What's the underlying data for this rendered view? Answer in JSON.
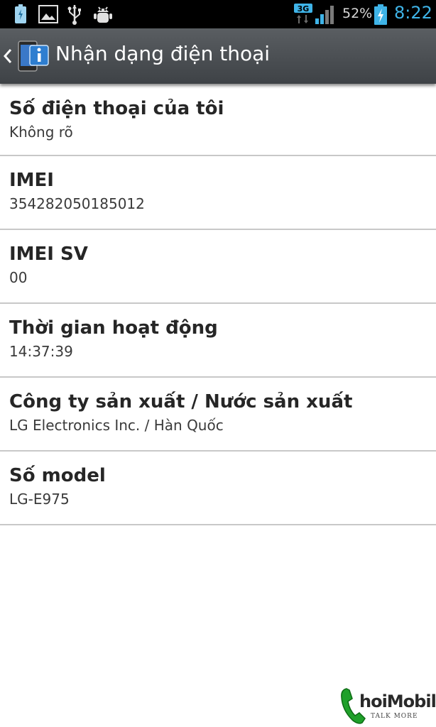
{
  "status_bar": {
    "notifications": [
      "battery-charging-notification-icon",
      "gallery-icon",
      "usb-icon",
      "debug-icon"
    ],
    "network": "3G",
    "battery_percent": "52%",
    "time": "8:22"
  },
  "action_bar": {
    "title": "Nhận dạng điện thoại"
  },
  "items": [
    {
      "label": "Số điện thoại của tôi",
      "value": "Không rõ"
    },
    {
      "label": "IMEI",
      "value": "354282050185012"
    },
    {
      "label": "IMEI SV",
      "value": "00"
    },
    {
      "label": "Thời gian hoạt động",
      "value": "14:37:39"
    },
    {
      "label": "Công ty sản xuất / Nước sản xuất",
      "value": "LG Electronics Inc. / Hàn Quốc"
    },
    {
      "label": "Số model",
      "value": "LG-E975"
    }
  ],
  "watermark": {
    "brand": "hoiMobile",
    "tagline": "TALK MORE"
  },
  "colors": {
    "clock": "#3fb4e8",
    "action_bar": "#4a4e52",
    "divider": "#c8c8c8",
    "watermark_green": "#1fa02a"
  }
}
